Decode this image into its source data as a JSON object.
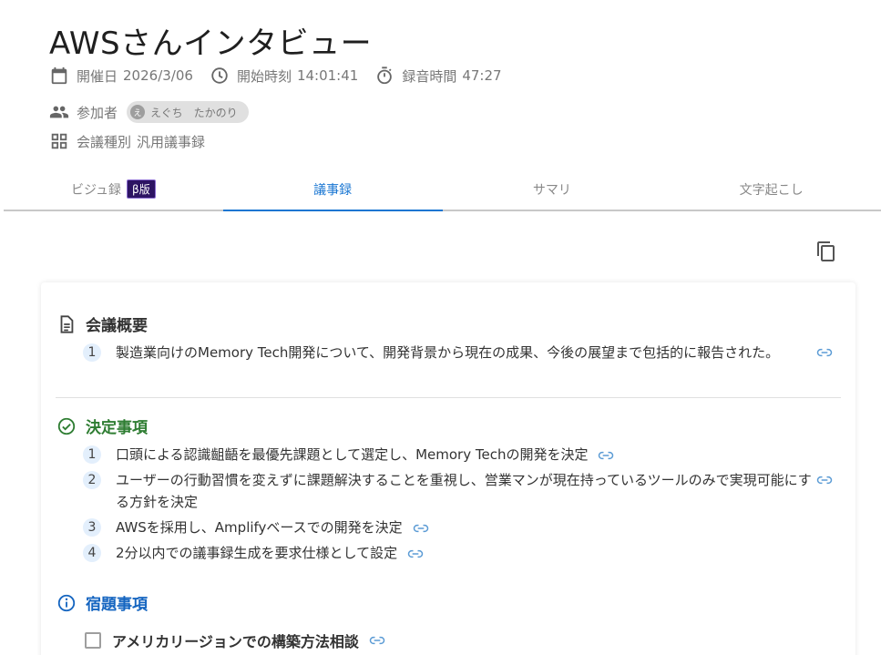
{
  "title": "AWSさんインタビュー",
  "meta": {
    "date_label": "開催日",
    "date_value": "2026/3/06",
    "start_label": "開始時刻",
    "start_value": "14:01:41",
    "duration_label": "録音時間",
    "duration_value": "47:27",
    "participants_label": "参加者",
    "participant_initial": "え",
    "participant_name": "えぐち　たかのり",
    "type_label": "会議種別",
    "type_value": "汎用議事録"
  },
  "tabs": [
    {
      "label": "ビジュ録",
      "badge": "β版"
    },
    {
      "label": "議事録"
    },
    {
      "label": "サマリ"
    },
    {
      "label": "文字起こし"
    }
  ],
  "active_tab": "議事録",
  "sections": {
    "overview": {
      "title": "会議概要",
      "items": [
        {
          "num": "1",
          "text": "製造業向けのMemory Tech開発について、開発背景から現在の成果、今後の展望まで包括的に報告された。"
        }
      ]
    },
    "decisions": {
      "title": "決定事項",
      "items": [
        {
          "num": "1",
          "text": "口頭による認識齟齬を最優先課題として選定し、Memory Techの開発を決定"
        },
        {
          "num": "2",
          "text": "ユーザーの行動習慣を変えずに課題解決することを重視し、営業マンが現在持っているツールのみで実現可能にする方針を決定"
        },
        {
          "num": "3",
          "text": "AWSを採用し、Amplifyベースでの開発を決定"
        },
        {
          "num": "4",
          "text": "2分以内での議事録生成を要求仕様として設定"
        }
      ]
    },
    "tasks": {
      "title": "宿題事項",
      "items": [
        {
          "text": "アメリカリージョンでの構築方法相談"
        }
      ]
    }
  },
  "colors": {
    "accent": "#1976d2",
    "decision_green": "#2e7d32",
    "task_blue": "#1565c0",
    "beta_bg": "#2d1463"
  }
}
